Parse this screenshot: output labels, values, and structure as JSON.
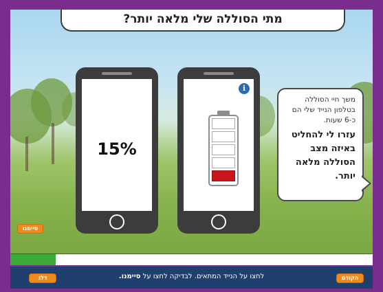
{
  "title": "מתי הסוללה שלי מלאה יותר?",
  "phones": {
    "left": {
      "percentage": "15%"
    },
    "right": {
      "info_glyph": "i",
      "battery_level_fraction": 0.2
    }
  },
  "bubble": {
    "info_text": "משך חיי הסוללה בטלפון הנייד שלי הם כ-6 שעות.",
    "task_text": "עזרו לי להחליט באיזה מצב הסוללה מלאה יותר."
  },
  "buttons": {
    "finish": "סיימנו",
    "skip": "דלג",
    "previous": "הקודם"
  },
  "progress": {
    "fraction": 0.125
  },
  "footer": {
    "instruction_prefix": "לחצו על הנייד המתאים. לבדיקה לחצו על ",
    "instruction_bold": "סיימנו."
  },
  "colors": {
    "frame": "#7b2d8e",
    "accent_orange": "#f08a1c",
    "progress_green": "#3aab3a",
    "footer_bg": "#1f3f6e",
    "battery_red": "#c8161d",
    "info_blue": "#2c6cb0"
  }
}
